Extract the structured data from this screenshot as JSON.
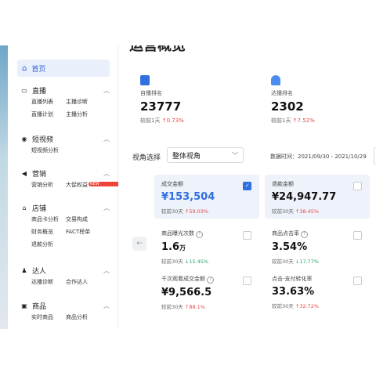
{
  "page": {
    "title": "运营概览"
  },
  "sidebar": {
    "home": {
      "label": "首页",
      "icon": "home-icon"
    },
    "groups": [
      {
        "label": "直播",
        "icon": "live-icon",
        "items": [
          [
            "直播列表",
            "主播诊断"
          ],
          [
            "直播计划",
            "主播分析"
          ]
        ]
      },
      {
        "label": "短视频",
        "icon": "video-icon",
        "items": [
          [
            "短视频分析"
          ]
        ]
      },
      {
        "label": "营销",
        "icon": "megaphone-icon",
        "items": [
          [
            "营销分析",
            "大促权益"
          ]
        ],
        "badge": "NEW"
      },
      {
        "label": "店铺",
        "icon": "store-icon",
        "items": [
          [
            "商品卡分析",
            "交易构成"
          ],
          [
            "财务概览",
            "FACT榜单"
          ],
          [
            "退款分析"
          ]
        ]
      },
      {
        "label": "达人",
        "icon": "person-icon",
        "items": [
          [
            "达播诊断",
            "合作达人"
          ]
        ]
      },
      {
        "label": "商品",
        "icon": "box-icon",
        "items": [
          [
            "实时商品",
            "商品分析"
          ]
        ]
      }
    ]
  },
  "stats": [
    {
      "label": "自播排名",
      "value": "23777",
      "compare_prefix": "较前1天",
      "compare": "0.73%",
      "trend": "up",
      "icon": "document-icon",
      "color": "#2f6fe0"
    },
    {
      "label": "达播排名",
      "value": "2302",
      "compare_prefix": "较前1天",
      "compare": "7.52%",
      "trend": "up",
      "icon": "user-icon",
      "color": "#4a8cf0"
    }
  ],
  "filters": {
    "view_label": "视角选择",
    "view_value": "整体视角",
    "data_time": "数据时间：2021/09/30 - 2021/10/29"
  },
  "metrics": [
    {
      "label": "成交金额",
      "value": "¥153,504",
      "compare_prefix": "较前30天",
      "compare": "59.03%",
      "trend": "up",
      "checked": true,
      "active": true
    },
    {
      "label": "退款金额",
      "value": "¥24,947.77",
      "compare_prefix": "较前30天",
      "compare": "38.45%",
      "trend": "up",
      "checked": false,
      "active": true
    },
    {
      "label": "商品曝光次数",
      "value": "1.6",
      "unit": "万",
      "compare_prefix": "较前30天",
      "compare": "15.45%",
      "trend": "down",
      "checked": false
    },
    {
      "label": "商品点击率",
      "value": "3.54%",
      "compare_prefix": "较前30天",
      "compare": "17.77%",
      "trend": "down",
      "checked": false
    },
    {
      "label": "千次观看成交金额",
      "value": "¥9,566.5",
      "compare_prefix": "较前30天",
      "compare": "88.1%",
      "trend": "up",
      "checked": false
    },
    {
      "label": "点击-支付转化率",
      "value": "33.63%",
      "compare_prefix": "较前30天",
      "compare": "32.72%",
      "trend": "up",
      "checked": false
    }
  ],
  "colors": {
    "accent": "#2f6fe0",
    "up": "#e5484d",
    "down": "#2ea56b"
  }
}
